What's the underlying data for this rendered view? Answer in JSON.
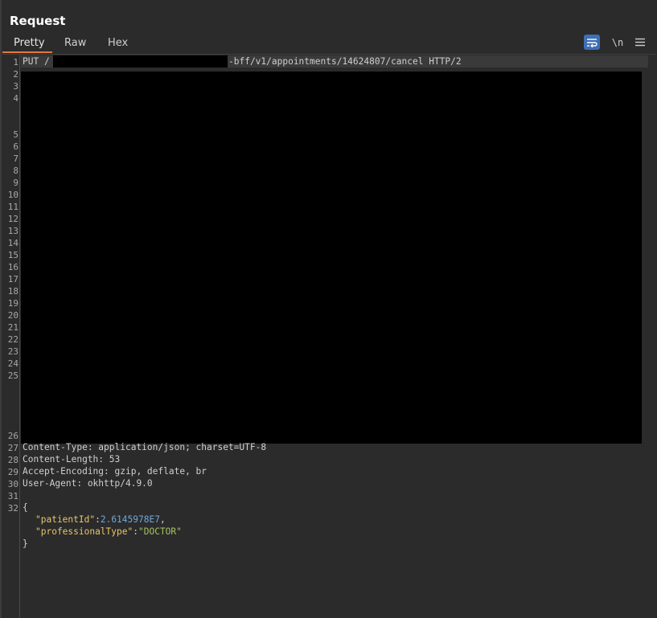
{
  "panel": {
    "title": "Request"
  },
  "tabs": {
    "pretty": "Pretty",
    "raw": "Raw",
    "hex": "Hex"
  },
  "toolbar": {
    "wrap_label": "↵",
    "newline_label": "\\n",
    "menu_label": "≡"
  },
  "line_numbers": [
    "1",
    "2",
    "3",
    "4",
    "5",
    "6",
    "7",
    "8",
    "9",
    "10",
    "11",
    "12",
    "13",
    "14",
    "15",
    "16",
    "17",
    "18",
    "19",
    "20",
    "21",
    "22",
    "23",
    "24",
    "25",
    "26",
    "27",
    "28",
    "29",
    "30",
    "31",
    "32"
  ],
  "request": {
    "method": "PUT /",
    "path_suffix": "-bff/v1/appointments/14624807/cancel HTTP/2",
    "headers": [
      "Content-Type: application/json; charset=UTF-8",
      "Content-Length: 53",
      "Accept-Encoding: gzip, deflate, br",
      "User-Agent: okhttp/4.9.0"
    ],
    "body": {
      "open_brace": "{",
      "patient_key": "\"patientId\"",
      "patient_value": "2.6145978E7",
      "professional_key": "\"professionalType\"",
      "professional_value": "\"DOCTOR\"",
      "close_brace": "}"
    }
  },
  "colors": {
    "accent": "#e8763d",
    "wrap_button": "#3d6fb5",
    "json_key": "#e9c46a",
    "json_number": "#6fa8dc",
    "json_string": "#a5c261"
  }
}
